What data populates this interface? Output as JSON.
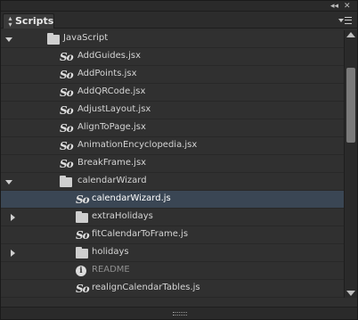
{
  "panel": {
    "title": "Scripts",
    "controls": {
      "collapse": "◂◂",
      "close": "✕"
    }
  },
  "tree": [
    {
      "label": "JavaScript",
      "kind": "folder",
      "expanded": true,
      "level": 0
    },
    {
      "label": "AddGuides.jsx",
      "kind": "script",
      "level": 1
    },
    {
      "label": "AddPoints.jsx",
      "kind": "script",
      "level": 1
    },
    {
      "label": "AddQRCode.jsx",
      "kind": "script",
      "level": 1
    },
    {
      "label": "AdjustLayout.jsx",
      "kind": "script",
      "level": 1
    },
    {
      "label": "AlignToPage.jsx",
      "kind": "script",
      "level": 1
    },
    {
      "label": "AnimationEncyclopedia.jsx",
      "kind": "script",
      "level": 1
    },
    {
      "label": "BreakFrame.jsx",
      "kind": "script",
      "level": 1
    },
    {
      "label": "calendarWizard",
      "kind": "folder",
      "expanded": true,
      "level": 1
    },
    {
      "label": "calendarWizard.js",
      "kind": "script",
      "level": 2,
      "selected": true
    },
    {
      "label": "extraHolidays",
      "kind": "folder",
      "expanded": false,
      "level": 2
    },
    {
      "label": "fitCalendarToFrame.js",
      "kind": "script",
      "level": 2
    },
    {
      "label": "holidays",
      "kind": "folder",
      "expanded": false,
      "level": 2
    },
    {
      "label": "README",
      "kind": "info",
      "level": 2
    },
    {
      "label": "realignCalendarTables.js",
      "kind": "script",
      "level": 2
    }
  ],
  "icons": {
    "folder": "folder-icon",
    "script": "javascript-file-icon",
    "info": "info-icon"
  },
  "colors": {
    "panel_bg": "#303030",
    "selected_row": "#3a4654",
    "text": "#d4d4d4"
  }
}
